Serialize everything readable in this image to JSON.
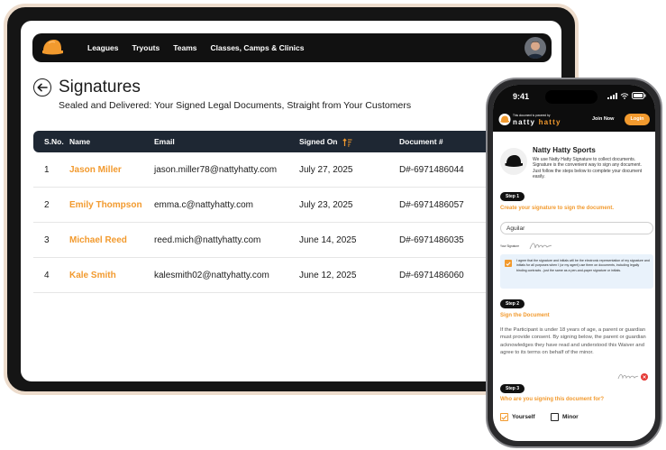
{
  "colors": {
    "accent": "#f29a2e",
    "dark": "#111111",
    "table_header": "#1e2733"
  },
  "nav": {
    "links": [
      "Leagues",
      "Tryouts",
      "Teams",
      "Classes, Camps & Clinics"
    ],
    "logo_icon": "cap-icon",
    "avatar_icon": "user-avatar"
  },
  "page": {
    "title": "Signatures",
    "subtitle": "Sealed and Delivered: Your Signed Legal Documents, Straight from Your Customers"
  },
  "table": {
    "columns": [
      "S.No.",
      "Name",
      "Email",
      "Signed On",
      "Document #"
    ],
    "rows": [
      {
        "sno": "1",
        "name": "Jason Miller",
        "email": "jason.miller78@nattyhatty.com",
        "signed_on": "July 27, 2025",
        "doc": "D#-6971486044"
      },
      {
        "sno": "2",
        "name": "Emily Thompson",
        "email": "emma.c@nattyhatty.com",
        "signed_on": "July 23, 2025",
        "doc": "D#-6971486057"
      },
      {
        "sno": "3",
        "name": "Michael Reed",
        "email": "reed.mich@nattyhatty.com",
        "signed_on": "June 14, 2025",
        "doc": "D#-6971486035"
      },
      {
        "sno": "4",
        "name": "Kale Smith",
        "email": "kalesmith02@nattyhatty.com",
        "signed_on": "June 12, 2025",
        "doc": "D#-6971486060"
      }
    ]
  },
  "phone": {
    "time": "9:41",
    "header": {
      "powered_by": "This document is powered by",
      "brand_a": "natty",
      "brand_b": "hatty",
      "join_now": "Join Now",
      "login": "Login"
    },
    "org": {
      "name": "Natty Hatty Sports",
      "description": "We use Natty Hatty Signature to collect documents. Signature is the convenient way to sign any document. Just follow the steps below to complete your document easily."
    },
    "step1": {
      "pill": "Step 1",
      "heading": "Create your signature to sign the document.",
      "input_value": "Aguilar",
      "your_signature_label": "Your Signature",
      "agree_text": "I agree that the signature and initials will be the electronic representation of my signature and initials for all purposes when I (or my agent) use them on documents, including legally binding contracts - just the same as a pen-and-paper signature or initials."
    },
    "step2": {
      "pill": "Step 2",
      "heading": "Sign the Document",
      "text": "If the Participant is under 18 years of age, a parent or guardian must provide consent. By signing below, the parent or guardian acknowledges they have read and understood this Waiver and agree to its terms on behalf of the minor."
    },
    "step3": {
      "pill": "Step 3",
      "heading": "Who are you signing this document for?",
      "options": [
        {
          "label": "Yourself",
          "checked": true
        },
        {
          "label": "Minor",
          "checked": false
        }
      ]
    }
  }
}
